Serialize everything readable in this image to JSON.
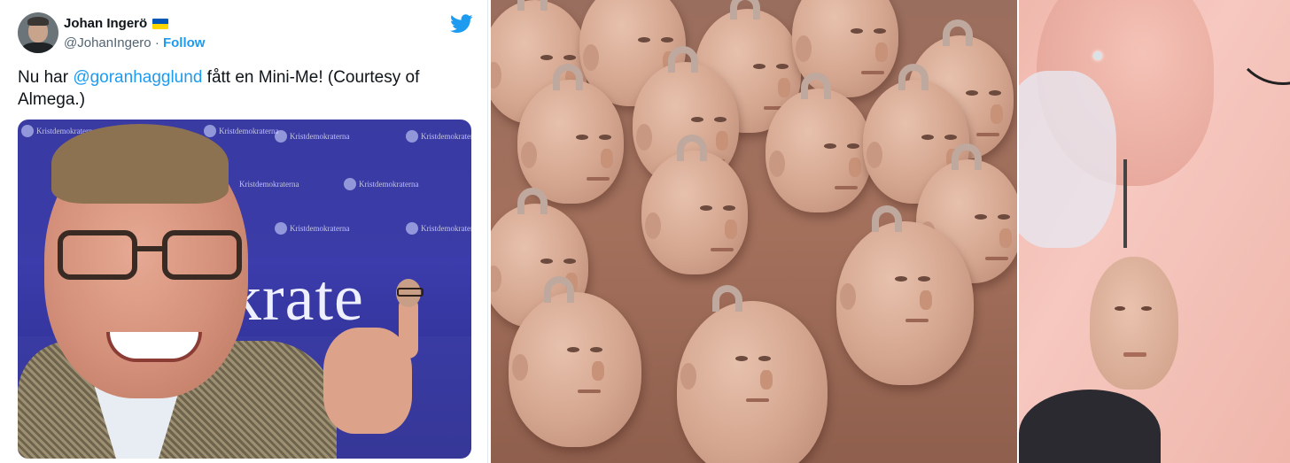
{
  "tweet": {
    "display_name": "Johan Ingerö",
    "handle": "@JohanIngero",
    "separator": "·",
    "follow_label": "Follow",
    "text_before": "Nu har ",
    "mention": "@goranhagglund",
    "text_after": " fått en Mini-Me! (Courtesy of Almega.)",
    "flag_colors": [
      "#0057b7",
      "#ffd700"
    ],
    "brand_color": "#1d9bf0",
    "icons": [
      "twitter-bird-icon",
      "ukraine-flag-icon"
    ]
  },
  "tweet_photo": {
    "banner_small": "Kristdemokraterna",
    "banner_big": "okrate"
  },
  "middle_photo": {
    "subject": "printed-heads"
  },
  "right_photo": {
    "subject": "earring"
  }
}
